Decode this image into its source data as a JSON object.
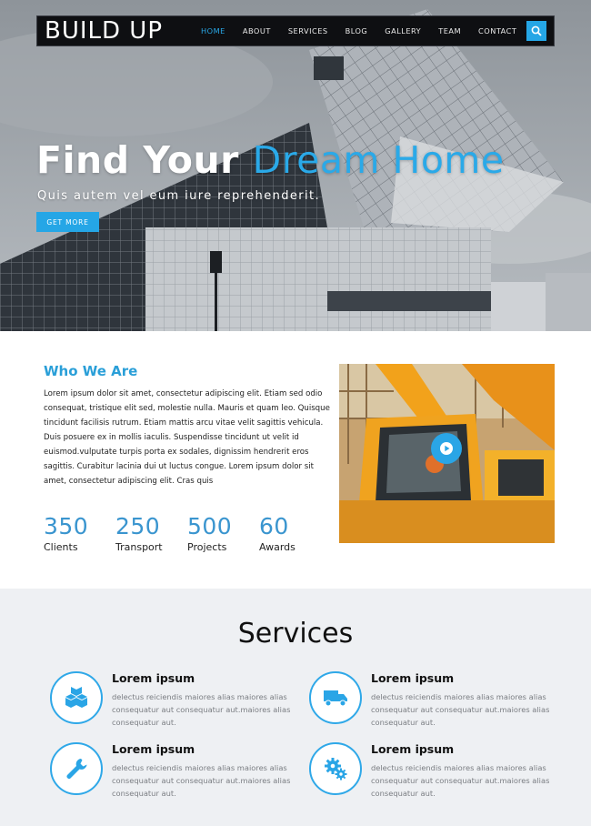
{
  "header": {
    "logo": "BUILD UP",
    "nav": [
      "HOME",
      "ABOUT",
      "SERVICES",
      "BLOG",
      "GALLERY",
      "TEAM",
      "CONTACT"
    ],
    "active_nav": "HOME",
    "search_icon": "search-icon"
  },
  "hero": {
    "title_part1": "Find Your ",
    "title_highlight": "Dream Home",
    "subtitle": "Quis autem vel eum iure reprehenderit.",
    "cta_label": "GET MORE"
  },
  "about": {
    "title": "Who We Are",
    "text": "Lorem ipsum dolor sit amet, consectetur adipiscing elit. Etiam sed odio consequat, tristique elit sed, molestie nulla. Mauris et quam leo. Quisque tincidunt facilisis rutrum. Etiam mattis arcu vitae velit sagittis vehicula. Duis posuere ex in mollis iaculis. Suspendisse tincidunt ut velit id euismod.vulputate turpis porta ex sodales, dignissim hendrerit eros sagittis. Curabitur lacinia dui ut luctus congue. Lorem ipsum dolor sit amet, consectetur adipiscing elit. Cras quis",
    "stats": [
      {
        "value": "350",
        "label": "Clients"
      },
      {
        "value": "250",
        "label": "Transport"
      },
      {
        "value": "500",
        "label": "Projects"
      },
      {
        "value": "60",
        "label": "Awards"
      }
    ],
    "play_icon": "play-icon"
  },
  "services": {
    "title": "Services",
    "items": [
      {
        "title": "Lorem ipsum",
        "desc": "delectus reiciendis maiores alias maiores alias consequatur aut consequatur aut.maiores alias consequatur aut.",
        "icon": "boxes-icon"
      },
      {
        "title": "Lorem ipsum",
        "desc": "delectus reiciendis maiores alias maiores alias consequatur aut consequatur aut.maiores alias consequatur aut.",
        "icon": "truck-icon"
      },
      {
        "title": "Lorem ipsum",
        "desc": "delectus reiciendis maiores alias maiores alias consequatur aut consequatur aut.maiores alias consequatur aut.",
        "icon": "wrench-icon"
      },
      {
        "title": "Lorem ipsum",
        "desc": "delectus reiciendis maiores alias maiores alias consequatur aut consequatur aut.maiores alias consequatur aut.",
        "icon": "gears-icon"
      }
    ]
  },
  "colors": {
    "accent": "#29a9e8",
    "navbar": "#0e0f12",
    "services_bg": "#eef0f3"
  }
}
